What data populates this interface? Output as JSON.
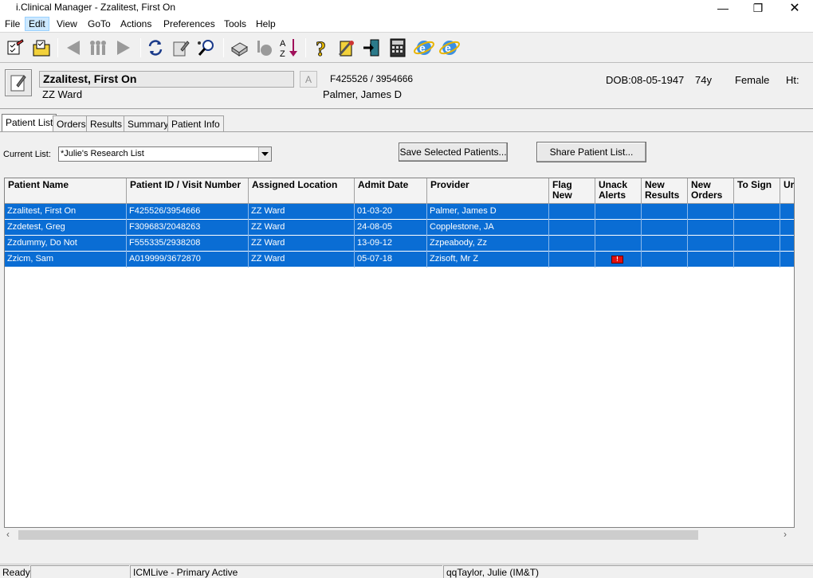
{
  "window": {
    "title": "i.Clinical Manager - Zzalitest, First On"
  },
  "menu": [
    "File",
    "Edit",
    "View",
    "GoTo",
    "Actions",
    "Preferences",
    "Tools",
    "Help"
  ],
  "patient": {
    "name": "Zzalitest, First On",
    "location": "ZZ Ward",
    "alert_button": "A",
    "ids": "F425526 / 3954666",
    "provider": "Palmer, James D",
    "dob": "DOB:08-05-1947",
    "age": "74y",
    "sex": "Female",
    "ht": "Ht:"
  },
  "tabs": [
    "Patient List",
    "Orders",
    "Results",
    "Summary",
    "Patient Info"
  ],
  "current_list": {
    "label": "Current List:",
    "value": "*Julie's Research List"
  },
  "buttons": {
    "save": "Save Selected Patients...",
    "share": "Share Patient List..."
  },
  "columns": [
    {
      "line1": "Patient Name",
      "line2": ""
    },
    {
      "line1": "Patient ID / Visit Number",
      "line2": ""
    },
    {
      "line1": "Assigned Location",
      "line2": ""
    },
    {
      "line1": "Admit Date",
      "line2": ""
    },
    {
      "line1": "Provider",
      "line2": ""
    },
    {
      "line1": "Flag",
      "line2": "New"
    },
    {
      "line1": "Unack",
      "line2": "Alerts"
    },
    {
      "line1": "New",
      "line2": "Results"
    },
    {
      "line1": "New",
      "line2": "Orders"
    },
    {
      "line1": "To Sign",
      "line2": ""
    },
    {
      "line1": "Ur",
      "line2": ""
    }
  ],
  "rows": [
    {
      "name": "Zzalitest, First On",
      "id": "F425526/3954666",
      "location": "ZZ Ward",
      "admit": "01-03-20",
      "provider": "Palmer, James D",
      "alert": false
    },
    {
      "name": "Zzdetest, Greg",
      "id": "F309683/2048263",
      "location": "ZZ Ward",
      "admit": "24-08-05",
      "provider": "Copplestone, JA",
      "alert": false
    },
    {
      "name": "Zzdummy, Do Not",
      "id": "F555335/2938208",
      "location": "ZZ Ward",
      "admit": "13-09-12",
      "provider": "Zzpeabody, Zz",
      "alert": false
    },
    {
      "name": "Zzicm, Sam",
      "id": "A019999/3672870",
      "location": "ZZ Ward",
      "admit": "05-07-18",
      "provider": "Zzisoft, Mr Z",
      "alert": true
    }
  ],
  "status": {
    "ready": "Ready",
    "empty": "",
    "server": "ICMLive - Primary Active",
    "user": "qqTaylor, Julie (IM&T)"
  },
  "colors": {
    "selection": "#0a6dd4",
    "alert_flag": "#e01010"
  }
}
